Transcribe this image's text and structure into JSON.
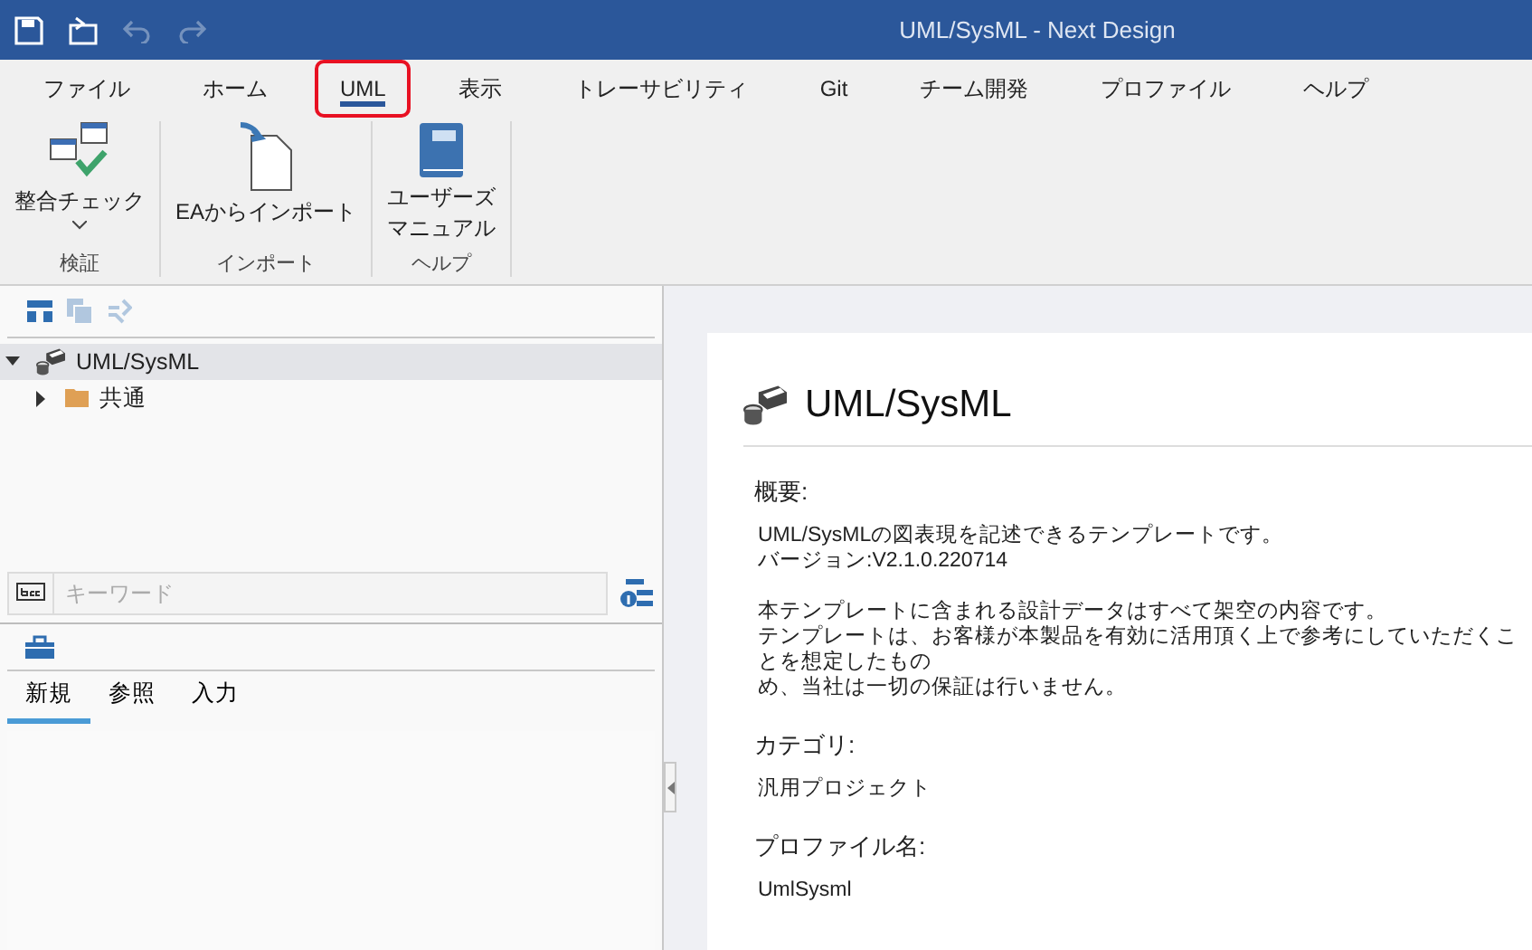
{
  "window": {
    "title": "UML/SysML - Next Design"
  },
  "quick_access": [
    {
      "kind": "save",
      "disabled": false
    },
    {
      "kind": "open",
      "disabled": false
    },
    {
      "kind": "undo",
      "disabled": true
    },
    {
      "kind": "redo",
      "disabled": true
    }
  ],
  "menu_tabs": [
    {
      "label": "ファイル",
      "selected": false,
      "highlighted": false
    },
    {
      "label": "ホーム",
      "selected": false,
      "highlighted": false
    },
    {
      "label": "UML",
      "selected": true,
      "highlighted": true
    },
    {
      "label": "表示",
      "selected": false,
      "highlighted": false
    },
    {
      "label": "トレーサビリティ",
      "selected": false,
      "highlighted": false
    },
    {
      "label": "Git",
      "selected": false,
      "highlighted": false
    },
    {
      "label": "チーム開発",
      "selected": false,
      "highlighted": false
    },
    {
      "label": "プロファイル",
      "selected": false,
      "highlighted": false
    },
    {
      "label": "ヘルプ",
      "selected": false,
      "highlighted": false
    }
  ],
  "ribbon_groups": [
    {
      "label": "検証",
      "buttons": [
        {
          "kind": "check",
          "lines": [
            "整合チェック"
          ],
          "dropdown": true
        }
      ]
    },
    {
      "label": "インポート",
      "buttons": [
        {
          "kind": "import",
          "lines": [
            "EAからインポート"
          ],
          "dropdown": false
        }
      ]
    },
    {
      "label": "ヘルプ",
      "buttons": [
        {
          "kind": "manual",
          "lines": [
            "ユーザーズ",
            "マニュアル"
          ],
          "dropdown": false
        }
      ]
    }
  ],
  "tree_toolbar": [
    {
      "kind": "hierarchy",
      "disabled": false
    },
    {
      "kind": "copy",
      "disabled": true
    },
    {
      "kind": "link",
      "disabled": true
    }
  ],
  "tree": [
    {
      "label": "UML/SysML",
      "kind": "project",
      "expanded": true,
      "selected": true,
      "children": [
        {
          "label": "共通",
          "kind": "folder",
          "expanded": false,
          "selected": false
        }
      ]
    }
  ],
  "search": {
    "placeholder": "キーワード"
  },
  "bottom_tabs": [
    {
      "label": "新規",
      "selected": true
    },
    {
      "label": "参照",
      "selected": false
    },
    {
      "label": "入力",
      "selected": false
    }
  ],
  "detail": {
    "title": "UML/SysML",
    "sections": [
      {
        "heading": "概要:",
        "paragraphs": [
          [
            "UML/SysMLの図表現を記述できるテンプレートです。",
            "バージョン:V2.1.0.220714"
          ],
          [
            "本テンプレートに含まれる設計データはすべて架空の内容です。",
            "テンプレートは、お客様が本製品を有効に活用頂く上で参考にしていただくことを想定したもの",
            "め、当社は一切の保証は行いません。"
          ]
        ]
      },
      {
        "heading": "カテゴリ:",
        "paragraphs": [
          [
            "汎用プロジェクト"
          ]
        ]
      },
      {
        "heading": "プロファイル名:",
        "paragraphs": [
          [
            "UmlSysml"
          ]
        ]
      }
    ]
  }
}
